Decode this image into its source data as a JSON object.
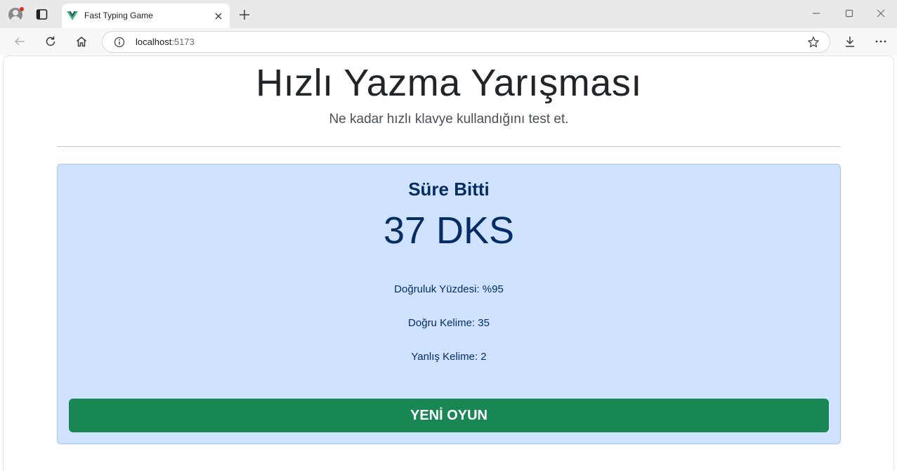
{
  "browser": {
    "tab_title": "Fast Typing Game",
    "url_host": "localhost",
    "url_port": ":5173",
    "icons": {
      "profile": "profile-avatar-icon",
      "tab_actions": "tab-actions-icon",
      "favicon": "vue-logo-icon",
      "tab_close": "close-icon",
      "new_tab": "plus-icon",
      "back": "arrow-left-icon",
      "reload": "reload-icon",
      "home": "home-icon",
      "info": "info-icon",
      "favorite": "star-icon",
      "download": "download-icon",
      "more": "more-icon"
    },
    "profile_badge_color": "#d93025"
  },
  "page": {
    "title": "Hızlı Yazma Yarışması",
    "subtitle": "Ne kadar hızlı klavye kullandığını test et."
  },
  "result": {
    "heading": "Süre Bitti",
    "wpm": "37 DKS",
    "accuracy": "Doğruluk Yüzdesi: %95",
    "correct_words": "Doğru Kelime: 35",
    "wrong_words": "Yanlış Kelime: 2",
    "new_game_label": "YENİ OYUN"
  },
  "colors": {
    "card_background": "#cfe2ff",
    "card_text": "#052c65",
    "button_background": "#198754",
    "vue_green": "#41b883",
    "vue_dark": "#34495e"
  }
}
